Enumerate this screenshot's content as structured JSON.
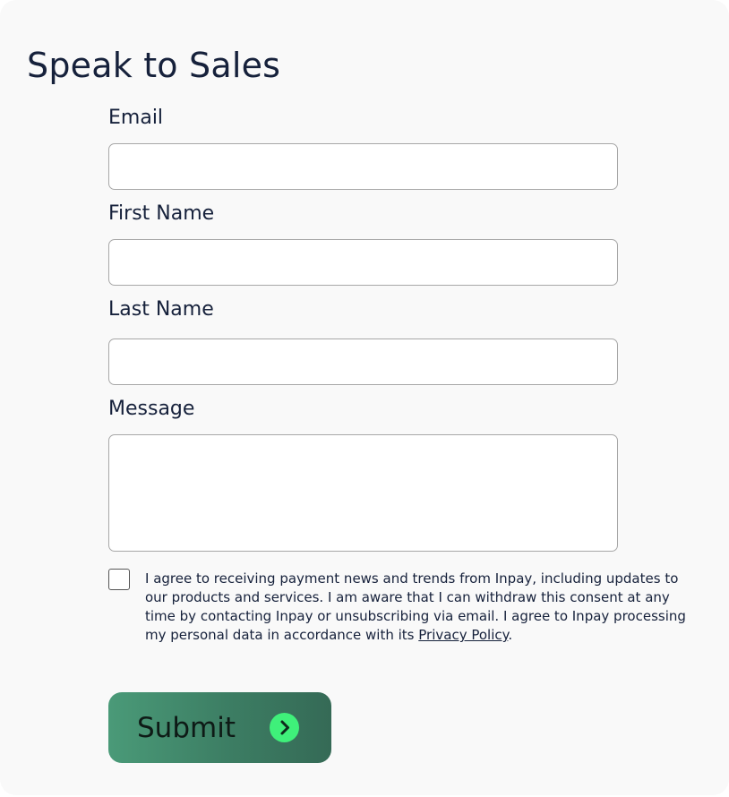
{
  "form": {
    "title": "Speak to Sales",
    "fields": {
      "email": {
        "label": "Email",
        "value": "",
        "placeholder": ""
      },
      "first_name": {
        "label": "First Name",
        "value": "",
        "placeholder": ""
      },
      "last_name": {
        "label": "Last Name",
        "value": "",
        "placeholder": ""
      },
      "message": {
        "label": "Message",
        "value": "",
        "placeholder": ""
      }
    },
    "consent": {
      "checked": false,
      "text": "I agree to receiving payment news and trends from Inpay, including updates to our products and services. I am aware that I can withdraw this consent at any time by contacting Inpay or unsubscribing via email. I agree to Inpay processing my personal data in accordance with its ",
      "link_text": "Privacy Policy",
      "suffix": "."
    },
    "submit": {
      "label": "Submit",
      "icon": "chevron-right-circle-icon",
      "icon_color": "#3ff07a"
    }
  },
  "colors": {
    "text": "#16213b",
    "background": "#f9f9f9",
    "button_gradient_start": "#4a9a78",
    "button_gradient_end": "#356a56"
  }
}
